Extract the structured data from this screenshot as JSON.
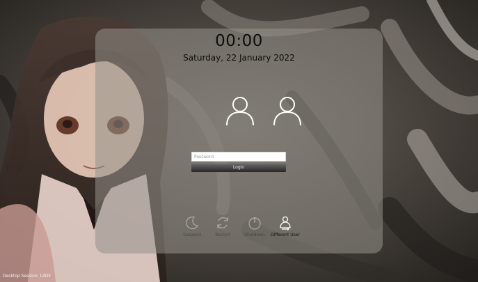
{
  "clock": {
    "time": "00:00",
    "date": "Saturday, 22 January 2022"
  },
  "users": [
    {
      "icon": "user-icon"
    },
    {
      "icon": "user-icon"
    }
  ],
  "login_form": {
    "password_placeholder": "Password",
    "password_value": "",
    "login_label": "Login"
  },
  "power": {
    "suspend_label": "Suspend",
    "restart_label": "Restart",
    "shutdown_label": "Shutdown",
    "different_user_label": "Different User"
  },
  "session": {
    "label": "Desktop Session: LXDE"
  },
  "colors": {
    "panel": "#96918a",
    "login_button_top": "#6a6a6a",
    "login_button_bottom": "#262626",
    "text_dark": "#0d0d0d"
  }
}
